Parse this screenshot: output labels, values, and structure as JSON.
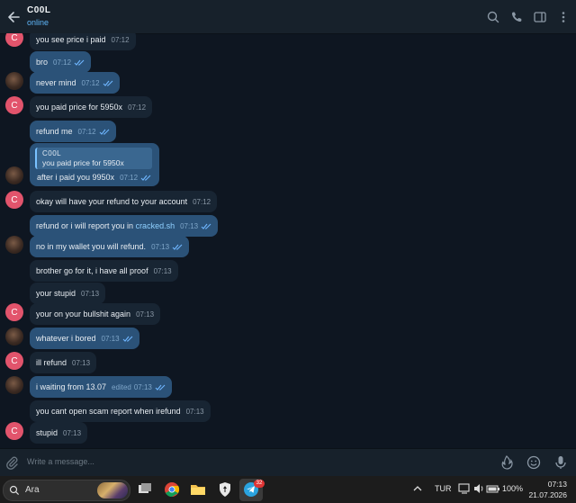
{
  "header": {
    "title": "C00L",
    "status": "online"
  },
  "messages": [
    {
      "side": "in",
      "avatar": "c",
      "text": "you see price i paid",
      "time": "07:12"
    },
    {
      "side": "out",
      "text": "bro",
      "time": "07:12"
    },
    {
      "side": "out",
      "avatar": "p",
      "text": "never mind",
      "time": "07:12"
    },
    {
      "side": "in",
      "avatar": "c",
      "text": "you paid price for 5950x",
      "time": "07:12"
    },
    {
      "side": "out",
      "text": "refund me",
      "time": "07:12"
    },
    {
      "side": "out",
      "avatar": "p",
      "quote": {
        "name": "C00L",
        "text": "you paid price for 5950x"
      },
      "text": "after i paid you 9950x",
      "time": "07:12"
    },
    {
      "side": "in",
      "avatar": "c",
      "text": "okay will have your refund to your account",
      "time": "07:12"
    },
    {
      "side": "out",
      "text": "refund or i will report you in ",
      "link": "cracked.sh",
      "time": "07:13"
    },
    {
      "side": "out",
      "avatar": "p",
      "text": "no in my wallet you will refund.",
      "time": "07:13"
    },
    {
      "side": "in",
      "text": "brother go for it, i have all proof",
      "time": "07:13"
    },
    {
      "side": "in",
      "text": "your stupid",
      "time": "07:13"
    },
    {
      "side": "in",
      "avatar": "c",
      "text": "your on your bullshit again",
      "time": "07:13"
    },
    {
      "side": "out",
      "avatar": "p",
      "text": "whatever i bored",
      "time": "07:13"
    },
    {
      "side": "in",
      "avatar": "c",
      "text": "ill refund",
      "time": "07:13"
    },
    {
      "side": "out",
      "avatar": "p",
      "text": "i waiting from 13.07",
      "edited": "edited",
      "time": "07:13"
    },
    {
      "side": "in",
      "text": "you cant open scam report when irefund",
      "time": "07:13"
    },
    {
      "side": "in",
      "avatar": "c",
      "text": "stupid",
      "time": "07:13"
    }
  ],
  "composer": {
    "placeholder": "Write a message..."
  },
  "taskbar": {
    "search_label": "Ara",
    "telegram_badge": "32",
    "language": "TUR",
    "battery": "100%",
    "time": "07:13",
    "date": "21.07.2026"
  },
  "colors": {
    "accent": "#5eb5f7",
    "outgoing": "#2b5278",
    "incoming": "#182533",
    "background": "#0e1621"
  },
  "icons": [
    "back-arrow-icon",
    "search-icon",
    "phone-icon",
    "sidebar-icon",
    "more-icon",
    "paperclip-icon",
    "bot-commands-icon",
    "emoji-icon",
    "microphone-icon"
  ]
}
